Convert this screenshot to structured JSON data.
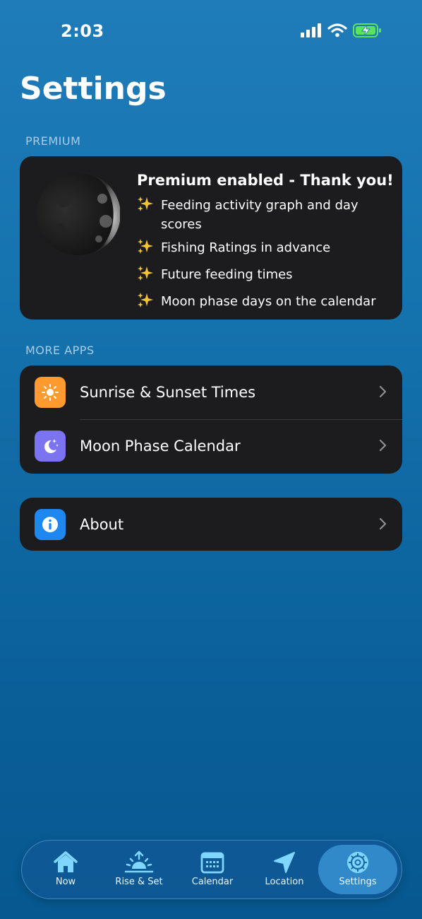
{
  "status_bar": {
    "time": "2:03",
    "battery_color": "#5be35b"
  },
  "page_title": "Settings",
  "premium_section": {
    "header": "PREMIUM",
    "title": "Premium enabled - Thank you!",
    "features": [
      "Feeding activity graph and day scores",
      "Fishing Ratings in advance",
      "Future feeding times",
      "Moon phase days on the calendar"
    ],
    "feature_icon": "sparkles-icon"
  },
  "more_apps_section": {
    "header": "MORE APPS",
    "items": [
      {
        "label": "Sunrise & Sunset Times",
        "icon": "sun-icon",
        "color": "#ff9a2e"
      },
      {
        "label": "Moon Phase Calendar",
        "icon": "moon-stars-icon",
        "color": "#7b73f0"
      }
    ]
  },
  "about": {
    "label": "About",
    "icon": "info-icon",
    "color": "#1e88f0"
  },
  "tab_bar": {
    "active": "Settings",
    "tabs": [
      {
        "label": "Now",
        "icon": "house-icon"
      },
      {
        "label": "Rise & Set",
        "icon": "sunrise-icon"
      },
      {
        "label": "Calendar",
        "icon": "calendar-icon"
      },
      {
        "label": "Location",
        "icon": "location-arrow-icon"
      },
      {
        "label": "Settings",
        "icon": "gear-icon"
      }
    ]
  },
  "colors": {
    "accent": "#7fd7ff",
    "card_bg": "#1c1c1e"
  }
}
